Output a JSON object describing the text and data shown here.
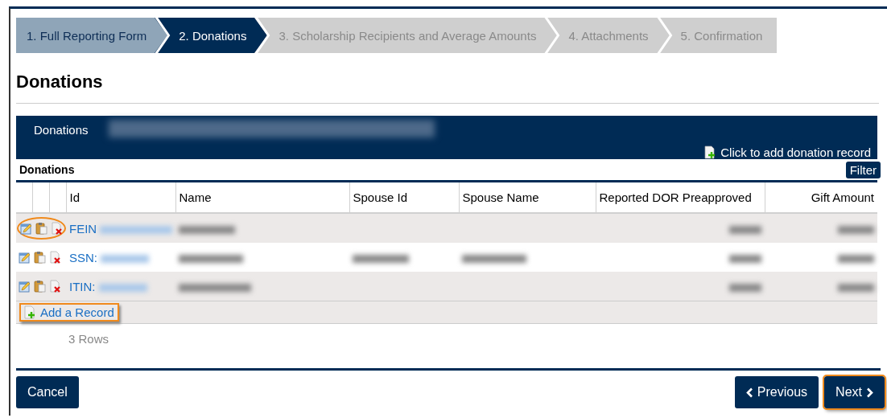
{
  "steps": [
    {
      "label": "1. Full Reporting Form",
      "completed": true,
      "selected": false
    },
    {
      "label": "2. Donations",
      "completed": false,
      "selected": true
    },
    {
      "label": "3. Scholarship Recipients and Average Amounts",
      "completed": false,
      "selected": false
    },
    {
      "label": "4. Attachments",
      "completed": false,
      "selected": false
    },
    {
      "label": "5. Confirmation",
      "completed": false,
      "selected": false
    }
  ],
  "page_title": "Donations",
  "panel": {
    "tab": "Donations",
    "add_link": "Click to add donation record"
  },
  "grid": {
    "title": "Donations",
    "filter_button": "Filter",
    "columns": [
      "Id",
      "Name",
      "Spouse Id",
      "Spouse Name",
      "Reported DOR Preapproved",
      "Gift Amount"
    ],
    "rows": [
      {
        "id": "FEIN",
        "actions_highlighted": true
      },
      {
        "id": "SSN:",
        "actions_highlighted": false
      },
      {
        "id": "ITIN:",
        "actions_highlighted": false
      }
    ],
    "add_record": {
      "label": "Add a Record",
      "highlighted": true
    },
    "row_count": "3 Rows"
  },
  "buttons": {
    "cancel": {
      "label": "Cancel",
      "highlighted": false
    },
    "previous": {
      "label": "Previous",
      "highlighted": false
    },
    "next": {
      "label": "Next",
      "highlighted": true
    }
  }
}
